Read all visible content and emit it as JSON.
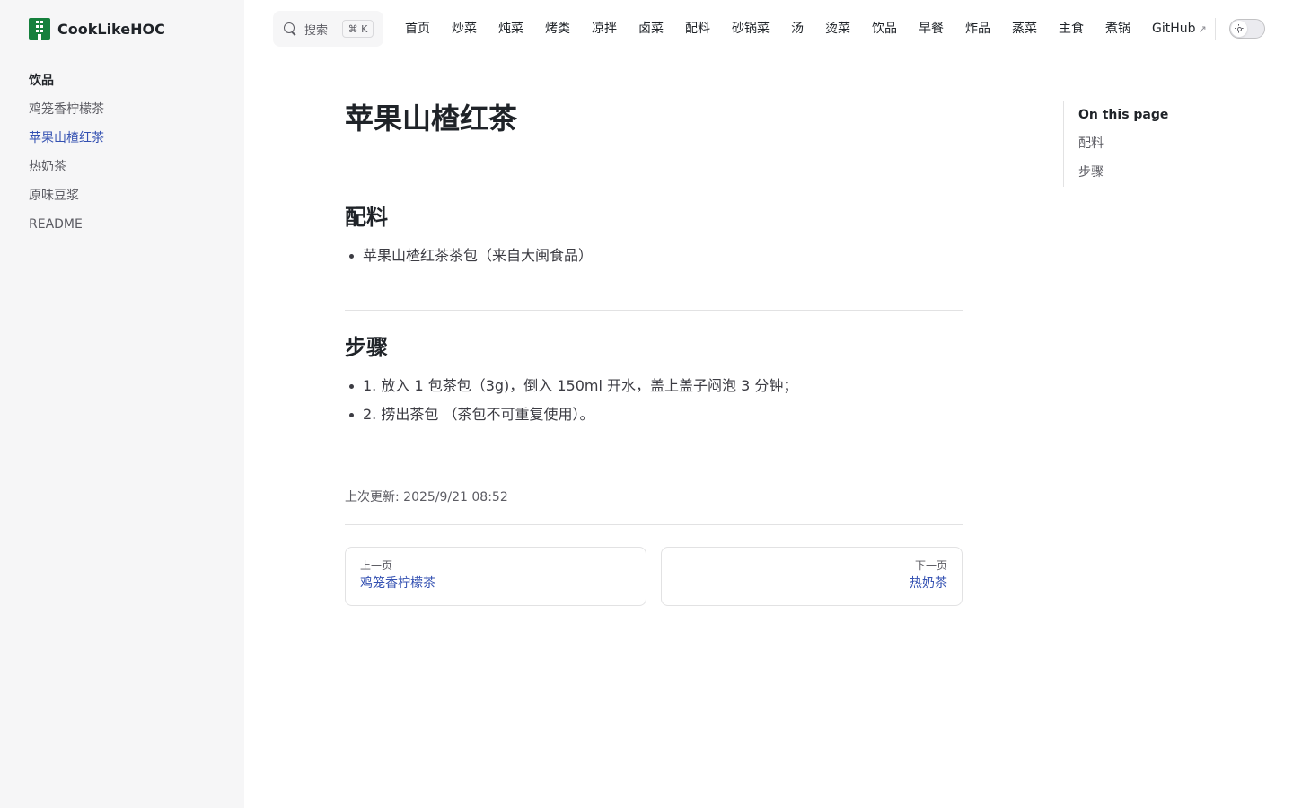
{
  "brand": {
    "name": "CookLikeHOC",
    "logo_icon": "building-grid-icon",
    "logo_color": "#15803d"
  },
  "sidebar": {
    "group": "饮品",
    "items": [
      {
        "label": "鸡笼香柠檬茶",
        "active": false
      },
      {
        "label": "苹果山楂红茶",
        "active": true
      },
      {
        "label": "热奶茶",
        "active": false
      },
      {
        "label": "原味豆浆",
        "active": false
      },
      {
        "label": "README",
        "active": false
      }
    ]
  },
  "search": {
    "placeholder": "搜索",
    "shortcut": "⌘ K"
  },
  "nav": {
    "items": [
      "首页",
      "炒菜",
      "炖菜",
      "烤类",
      "凉拌",
      "卤菜",
      "配料",
      "砂锅菜",
      "汤",
      "烫菜",
      "饮品",
      "早餐",
      "炸品",
      "蒸菜",
      "主食",
      "煮锅"
    ],
    "github": "GitHub",
    "external_icon": "↗"
  },
  "article": {
    "title": "苹果山楂红茶",
    "sections": [
      {
        "heading": "配料",
        "items": [
          "苹果山楂红茶茶包（来自大闽食品）"
        ]
      },
      {
        "heading": "步骤",
        "items": [
          "1. 放入 1 包茶包（3g)，倒入 150ml 开水，盖上盖子闷泡 3 分钟；",
          "2. 捞出茶包 （茶包不可重复使用）。"
        ]
      }
    ],
    "last_updated": "上次更新: 2025/9/21 08:52"
  },
  "pager": {
    "prev": {
      "desc": "上一页",
      "title": "鸡笼香柠檬茶"
    },
    "next": {
      "desc": "下一页",
      "title": "热奶茶"
    }
  },
  "outline": {
    "title": "On this page",
    "items": [
      "配料",
      "步骤"
    ]
  },
  "colors": {
    "accent": "#3451b2",
    "sidebar_bg": "#f6f6f7",
    "text": "#3c3c43"
  }
}
